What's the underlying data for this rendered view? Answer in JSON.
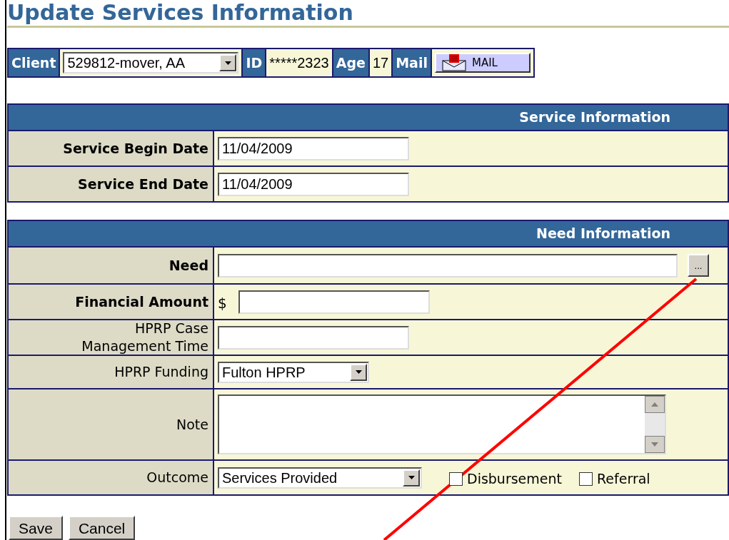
{
  "title": "Update Services Information",
  "client_bar": {
    "client_label": "Client",
    "client_select": "529812-mover, AA",
    "id_label": "ID",
    "id_value": "*****2323",
    "age_label": "Age",
    "age_value": "17",
    "mail_label": "Mail",
    "mail_button": "MAIL"
  },
  "sections": [
    {
      "heading": "Service Information",
      "rows": [
        {
          "kind": "text",
          "label": "Service Begin Date",
          "bold": true,
          "value": "11/04/2009"
        },
        {
          "kind": "text",
          "label": "Service End Date",
          "bold": true,
          "value": "11/04/2009"
        }
      ]
    },
    {
      "heading": "Need Information",
      "rows": [
        {
          "kind": "lookup",
          "label": "Need",
          "bold": true,
          "button": "..."
        },
        {
          "kind": "money",
          "label": "Financial Amount",
          "bold": true,
          "prefix": "$"
        },
        {
          "kind": "text",
          "label": "HPRP Case\nManagement Time",
          "bold": false
        },
        {
          "kind": "select",
          "label": "HPRP Funding",
          "bold": false,
          "value": "Fulton HPRP"
        },
        {
          "kind": "textarea",
          "label": "Note",
          "bold": false
        },
        {
          "kind": "outcome",
          "label": "Outcome",
          "bold": false,
          "value": "Services Provided",
          "checkboxes": [
            {
              "label": "Disbursement",
              "checked": false
            },
            {
              "label": "Referral",
              "checked": false
            }
          ]
        }
      ]
    }
  ],
  "buttons": [
    "Save",
    "Cancel"
  ]
}
